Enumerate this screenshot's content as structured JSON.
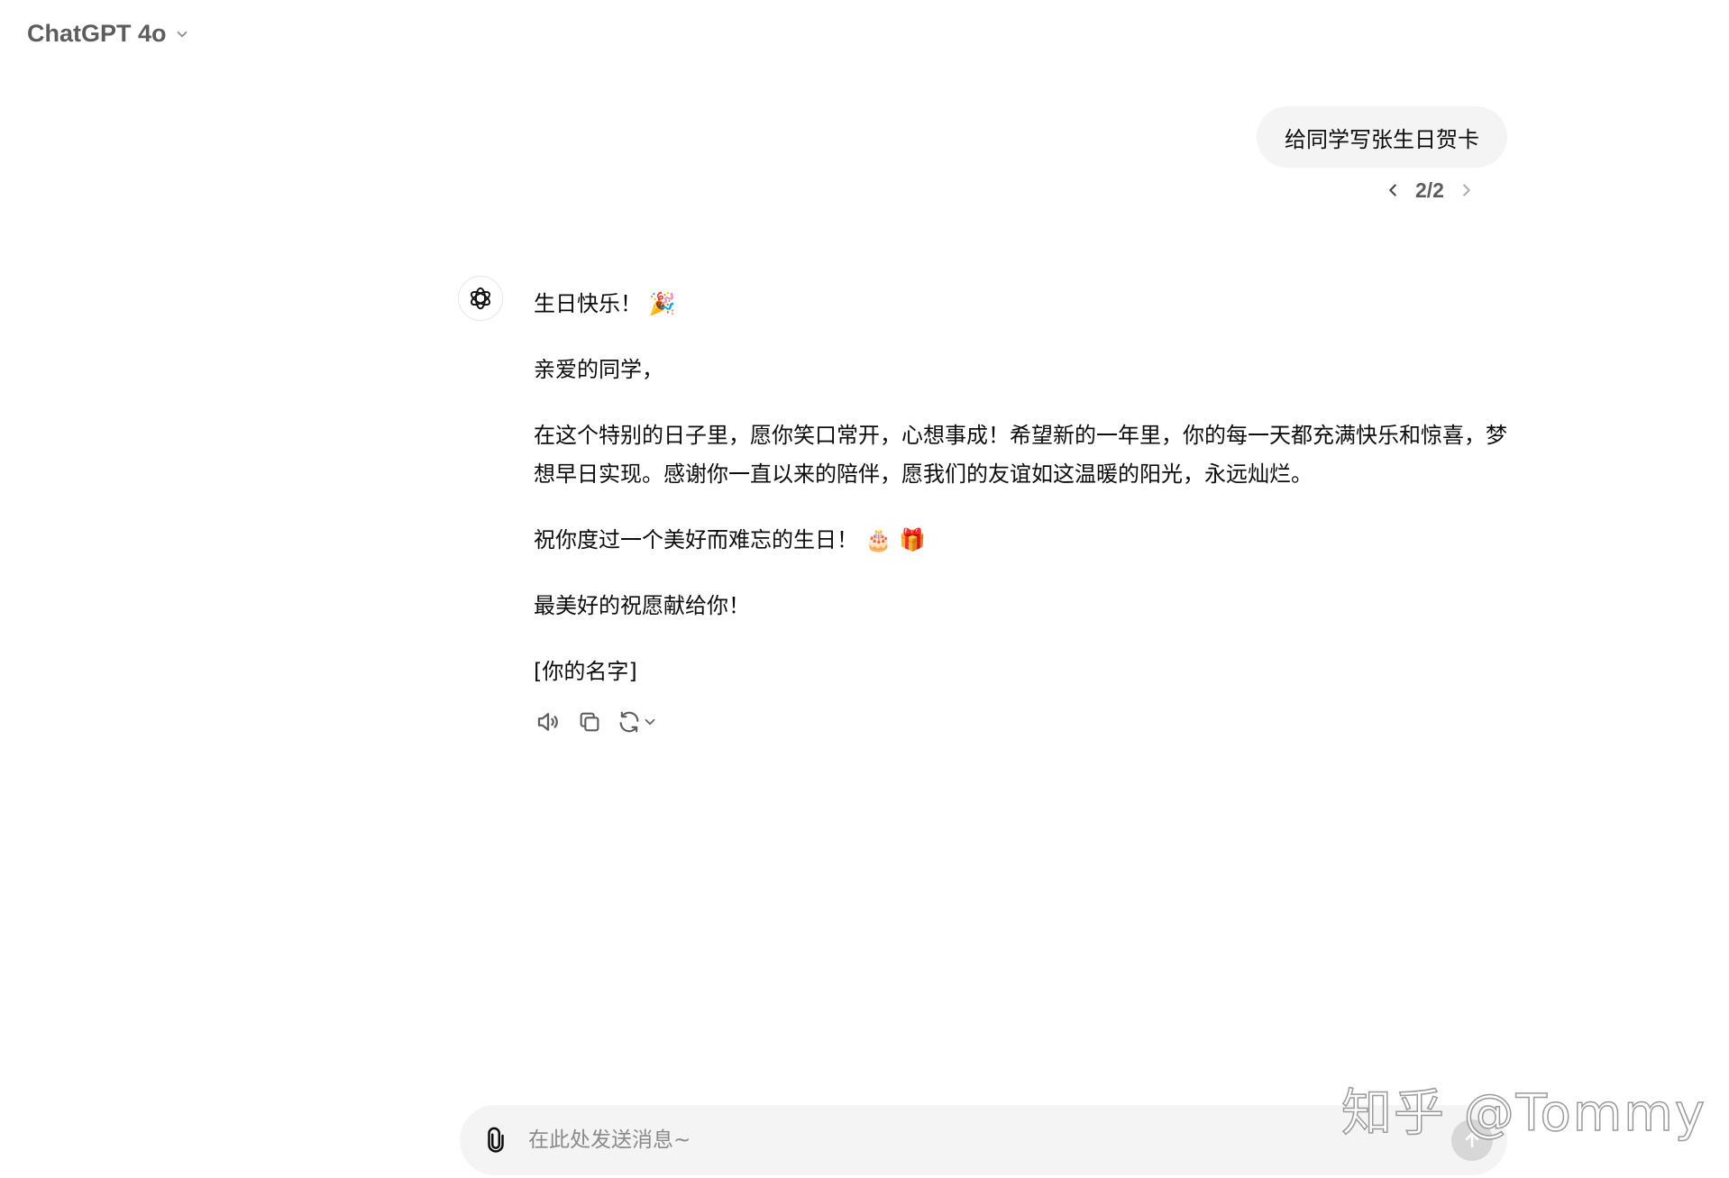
{
  "header": {
    "model_name": "ChatGPT 4o"
  },
  "user_message": {
    "text": "给同学写张生日贺卡",
    "pager": "2/2"
  },
  "assistant_message": {
    "paragraphs": [
      "生日快乐！ 🎉",
      "亲爱的同学，",
      "在这个特别的日子里，愿你笑口常开，心想事成！希望新的一年里，你的每一天都充满快乐和惊喜，梦想早日实现。感谢你一直以来的陪伴，愿我们的友谊如这温暖的阳光，永远灿烂。",
      "祝你度过一个美好而难忘的生日！ 🎂 🎁",
      "最美好的祝愿献给你！",
      "[你的名字]"
    ]
  },
  "composer": {
    "placeholder": "在此处发送消息~"
  },
  "watermark": {
    "text": "知乎 @Tommy"
  },
  "icons": {
    "model_dropdown": "chevron-down-icon",
    "pager_prev": "chevron-left-icon",
    "pager_next": "chevron-right-icon",
    "avatar": "openai-logo-icon",
    "read_aloud": "speaker-icon",
    "copy": "copy-icon",
    "regenerate": "refresh-icon",
    "attach": "paperclip-icon",
    "send": "arrow-up-icon"
  },
  "colors": {
    "bubble_bg": "#f4f4f4",
    "muted_text": "#5d5d5d",
    "send_disabled": "#d7d7d7"
  }
}
